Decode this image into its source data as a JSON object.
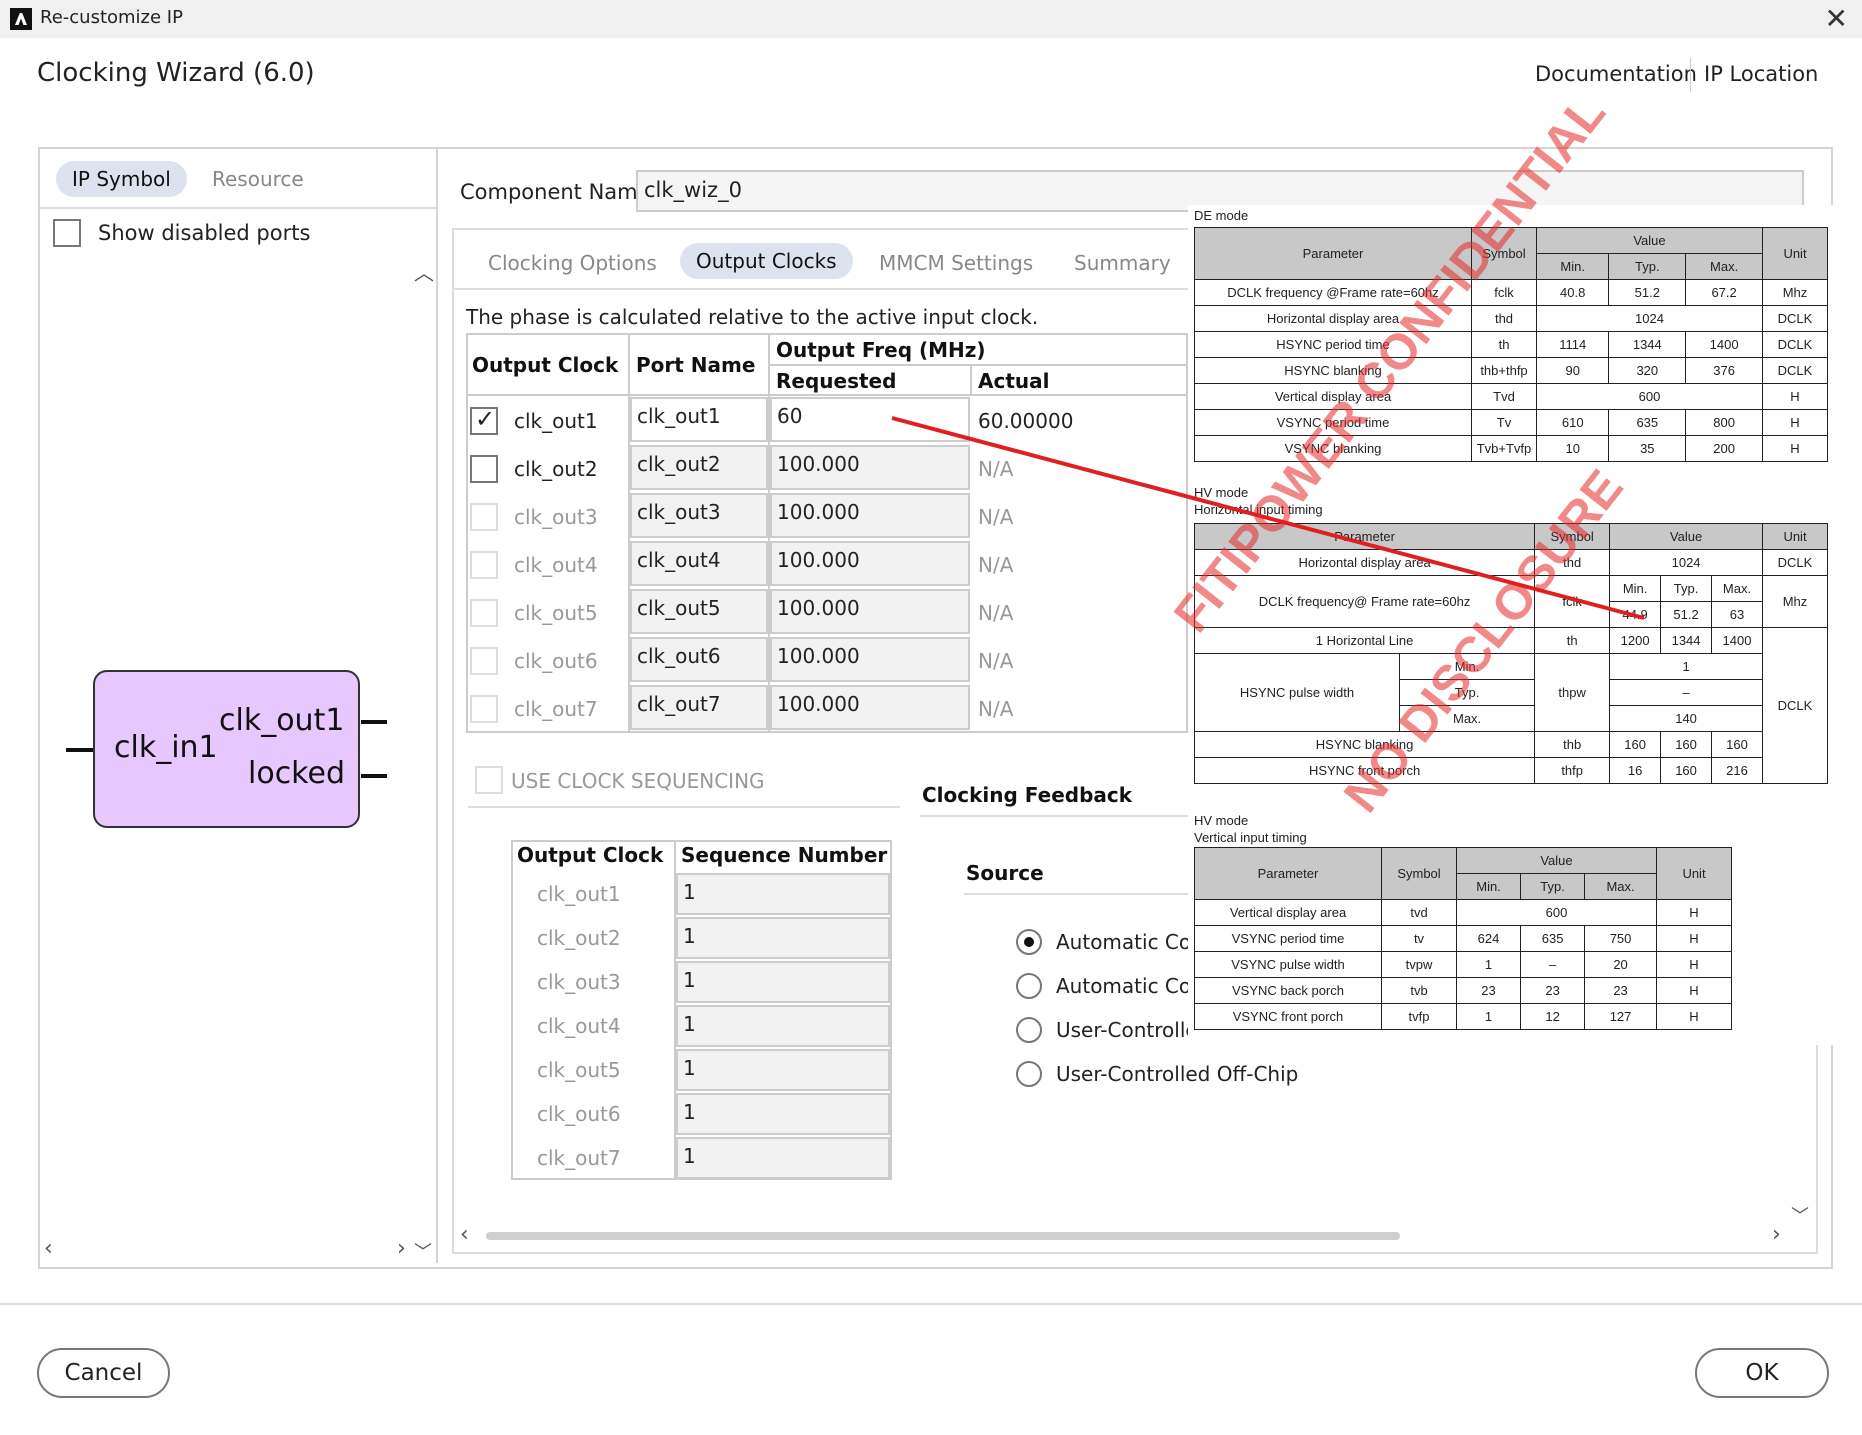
{
  "window": {
    "title": "Re-customize IP"
  },
  "wizard": {
    "title": "Clocking Wizard (6.0)"
  },
  "links": {
    "documentation": "Documentation",
    "ip_location": "IP Location"
  },
  "left_panel": {
    "tabs": [
      "IP Symbol",
      "Resource"
    ],
    "show_disabled_ports": "Show disabled ports",
    "symbol": {
      "input": "clk_in1",
      "output1": "clk_out1",
      "output2": "locked"
    }
  },
  "component": {
    "label": "Component Name",
    "value": "clk_wiz_0"
  },
  "tabs": [
    "Clocking Options",
    "Output Clocks",
    "MMCM Settings",
    "Summary"
  ],
  "note": "The phase is calculated relative to the active input clock.",
  "output_table": {
    "headers": {
      "output_clock": "Output Clock",
      "port_name": "Port Name",
      "output_freq": "Output Freq (MHz)",
      "requested": "Requested",
      "actual": "Actual"
    },
    "rows": [
      {
        "clock": "clk_out1",
        "port": "clk_out1",
        "requested": "60",
        "actual": "60.00000",
        "checked": true,
        "enabled": true
      },
      {
        "clock": "clk_out2",
        "port": "clk_out2",
        "requested": "100.000",
        "actual": "N/A",
        "checked": false,
        "enabled": true
      },
      {
        "clock": "clk_out3",
        "port": "clk_out3",
        "requested": "100.000",
        "actual": "N/A",
        "checked": false,
        "enabled": false
      },
      {
        "clock": "clk_out4",
        "port": "clk_out4",
        "requested": "100.000",
        "actual": "N/A",
        "checked": false,
        "enabled": false
      },
      {
        "clock": "clk_out5",
        "port": "clk_out5",
        "requested": "100.000",
        "actual": "N/A",
        "checked": false,
        "enabled": false
      },
      {
        "clock": "clk_out6",
        "port": "clk_out6",
        "requested": "100.000",
        "actual": "N/A",
        "checked": false,
        "enabled": false
      },
      {
        "clock": "clk_out7",
        "port": "clk_out7",
        "requested": "100.000",
        "actual": "N/A",
        "checked": false,
        "enabled": false
      }
    ]
  },
  "sequencing": {
    "label": "USE CLOCK SEQUENCING",
    "headers": {
      "output_clock": "Output Clock",
      "sequence_number": "Sequence Number"
    },
    "rows": [
      {
        "clock": "clk_out1",
        "seq": "1"
      },
      {
        "clock": "clk_out2",
        "seq": "1"
      },
      {
        "clock": "clk_out3",
        "seq": "1"
      },
      {
        "clock": "clk_out4",
        "seq": "1"
      },
      {
        "clock": "clk_out5",
        "seq": "1"
      },
      {
        "clock": "clk_out6",
        "seq": "1"
      },
      {
        "clock": "clk_out7",
        "seq": "1"
      }
    ]
  },
  "feedback": {
    "title": "Clocking Feedback",
    "source": "Source",
    "options": [
      "Automatic Cor",
      "Automatic Cor",
      "User-Controlle",
      "User-Controlled Off-Chip"
    ],
    "selected_index": 0
  },
  "buttons": {
    "cancel": "Cancel",
    "ok": "OK"
  },
  "overlay_doc": {
    "de_mode": "DE mode",
    "hv_mode": "HV mode",
    "horizontal_timing": "Horizontal input timing",
    "vertical_timing": "Vertical input timing",
    "headers": {
      "parameter": "Parameter",
      "symbol": "Symbol",
      "value": "Value",
      "unit": "Unit",
      "min": "Min.",
      "typ": "Typ.",
      "max": "Max."
    },
    "de_rows": [
      [
        "DCLK frequency @Frame rate=60hz",
        "fclk",
        "40.8",
        "51.2",
        "67.2",
        "Mhz"
      ],
      [
        "Horizontal display area",
        "thd",
        "",
        "1024",
        "",
        "DCLK"
      ],
      [
        "HSYNC period time",
        "th",
        "1114",
        "1344",
        "1400",
        "DCLK"
      ],
      [
        "HSYNC blanking",
        "thb+thfp",
        "90",
        "320",
        "376",
        "DCLK"
      ],
      [
        "Vertical display area",
        "Tvd",
        "",
        "600",
        "",
        "H"
      ],
      [
        "VSYNC period time",
        "Tv",
        "610",
        "635",
        "800",
        "H"
      ],
      [
        "VSYNC blanking",
        "Tvb+Tvfp",
        "10",
        "35",
        "200",
        "H"
      ]
    ],
    "hv_h_rows": [
      [
        "Horizontal display area",
        "thd",
        "",
        "1024",
        "",
        "DCLK"
      ],
      [
        "DCLK frequency@ Frame rate=60hz",
        "fclk",
        "44.9",
        "51.2",
        "63",
        "Mhz"
      ],
      [
        "1 Horizontal Line",
        "th",
        "1200",
        "1344",
        "1400",
        ""
      ],
      [
        "HSYNC pulse width",
        "thpw",
        "Min.",
        "1",
        "",
        "DCLK"
      ],
      [
        "",
        "",
        "Typ.",
        "–",
        "",
        ""
      ],
      [
        "",
        "",
        "Max.",
        "140",
        "",
        ""
      ],
      [
        "HSYNC blanking",
        "thb",
        "160",
        "160",
        "160",
        ""
      ],
      [
        "HSYNC front porch",
        "thfp",
        "16",
        "160",
        "216",
        ""
      ]
    ],
    "hv_v_rows": [
      [
        "Vertical display area",
        "tvd",
        "",
        "600",
        "",
        "H"
      ],
      [
        "VSYNC period time",
        "tv",
        "624",
        "635",
        "750",
        "H"
      ],
      [
        "VSYNC pulse width",
        "tvpw",
        "1",
        "–",
        "20",
        "H"
      ],
      [
        "VSYNC back porch",
        "tvb",
        "23",
        "23",
        "23",
        "H"
      ],
      [
        "VSYNC front porch",
        "tvfp",
        "1",
        "12",
        "127",
        "H"
      ]
    ],
    "watermark1": "FITIPOWER CONFIDENTIAL",
    "watermark2": "NO DISCLOSURE"
  }
}
